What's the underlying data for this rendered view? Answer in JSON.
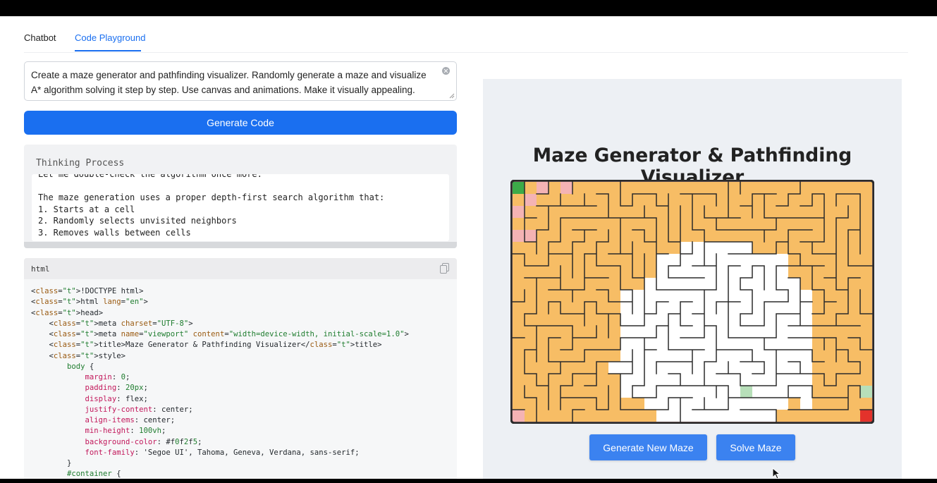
{
  "tabs": [
    {
      "label": "Chatbot",
      "active": false
    },
    {
      "label": "Code Playground",
      "active": true
    }
  ],
  "prompt": {
    "value": "Create a maze generator and pathfinding visualizer. Randomly generate a maze and visualize A* algorithm solving it step by step. Use canvas and animations. Make it visually appealing."
  },
  "generate_button": {
    "label": "Generate Code"
  },
  "thinking": {
    "title": "Thinking Process",
    "text": "Let me double-check the algorithm once more.\n\nThe maze generation uses a proper depth-first search algorithm that:\n1. Starts at a cell\n2. Randomly selects unvisited neighbors\n3. Removes walls between cells"
  },
  "code": {
    "language": "html",
    "lines": [
      "<!DOCTYPE html>",
      "<html lang=\"en\">",
      "<head>",
      "    <meta charset=\"UTF-8\">",
      "    <meta name=\"viewport\" content=\"width=device-width, initial-scale=1.0\">",
      "    <title>Maze Generator & Pathfinding Visualizer</title>",
      "    <style>",
      "        body {",
      "            margin: 0;",
      "            padding: 20px;",
      "            display: flex;",
      "            justify-content: center;",
      "            align-items: center;",
      "            min-height: 100vh;",
      "            background-color: #f0f2f5;",
      "            font-family: 'Segoe UI', Tahoma, Geneva, Verdana, sans-serif;",
      "        }",
      "        #container {"
    ]
  },
  "preview": {
    "title": "Maze Generator & Pathfinding Visualizer",
    "buttons": {
      "new_maze": "Generate New Maze",
      "solve": "Solve Maze"
    },
    "colors": {
      "wall": "#2b2b2b",
      "unvisited": "#f4b3b4",
      "visited": "#f7bd65",
      "path": "#ffffff",
      "open_set": "#b7dfb9",
      "start": "#3cab48",
      "end": "#e3322b"
    }
  }
}
